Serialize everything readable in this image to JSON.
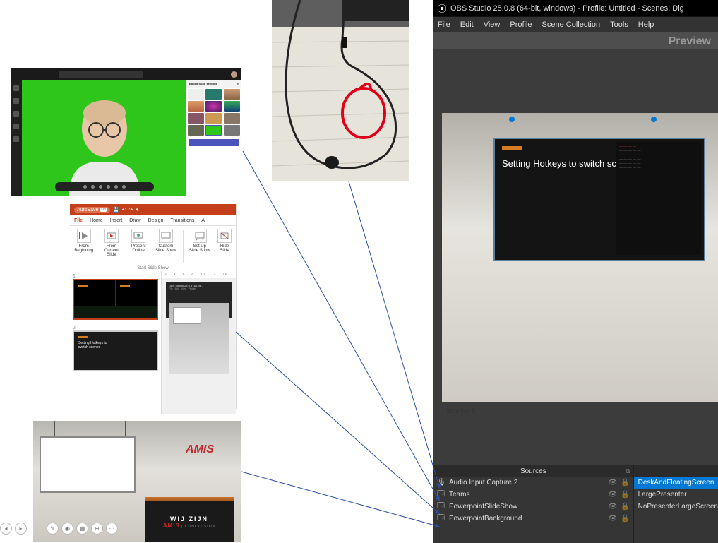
{
  "teams": {
    "panel_title": "Background settings",
    "apply": "Apply"
  },
  "ppt": {
    "autosave": "AutoSave",
    "tabs": [
      "File",
      "Home",
      "Insert",
      "Draw",
      "Design",
      "Transitions",
      "A"
    ],
    "ribbon": {
      "from_beginning": "From Beginning",
      "from_current": "From Current Slide",
      "present_online": "Present Online",
      "custom": "Custom Slide Show",
      "setup": "Set Up Slide Show",
      "hide": "Hide Slide",
      "section": "Start Slide Show"
    },
    "thumb2_text": "Setting Hotkeys to switch scenes",
    "ruler": [
      "2",
      "4",
      "6",
      "8",
      "10",
      "12",
      "14"
    ],
    "mini_title": "OBS Studio 25.0.8 (64-bit...",
    "mini_menu": [
      "File",
      "Edit",
      "View",
      "Profile"
    ]
  },
  "vset": {
    "logo": "AMIS",
    "lectern1": "WIJ ZIJN",
    "lectern2": "AMIS"
  },
  "obs": {
    "title": "OBS Studio 25.0.8 (64-bit, windows) - Profile: Untitled - Scenes: Dig",
    "menu": [
      "File",
      "Edit",
      "View",
      "Profile",
      "Scene Collection",
      "Tools",
      "Help"
    ],
    "preview": "Preview",
    "slide_title": "Setting Hotkeys to switch scenes",
    "slide_ind": "Slide 6 of 6",
    "sources_title": "Sources",
    "sources": [
      {
        "icon": "mic",
        "name": "Audio Input Capture 2"
      },
      {
        "icon": "win",
        "name": "Teams"
      },
      {
        "icon": "win",
        "name": "PowerpointSlideShow"
      },
      {
        "icon": "win",
        "name": "PowerpointBackground"
      }
    ],
    "scenes": [
      {
        "name": "DeskAndFloatingScreen",
        "sel": true
      },
      {
        "name": "LargePresenter",
        "sel": false
      },
      {
        "name": "NoPresenterLargeScreen",
        "sel": false
      }
    ]
  }
}
